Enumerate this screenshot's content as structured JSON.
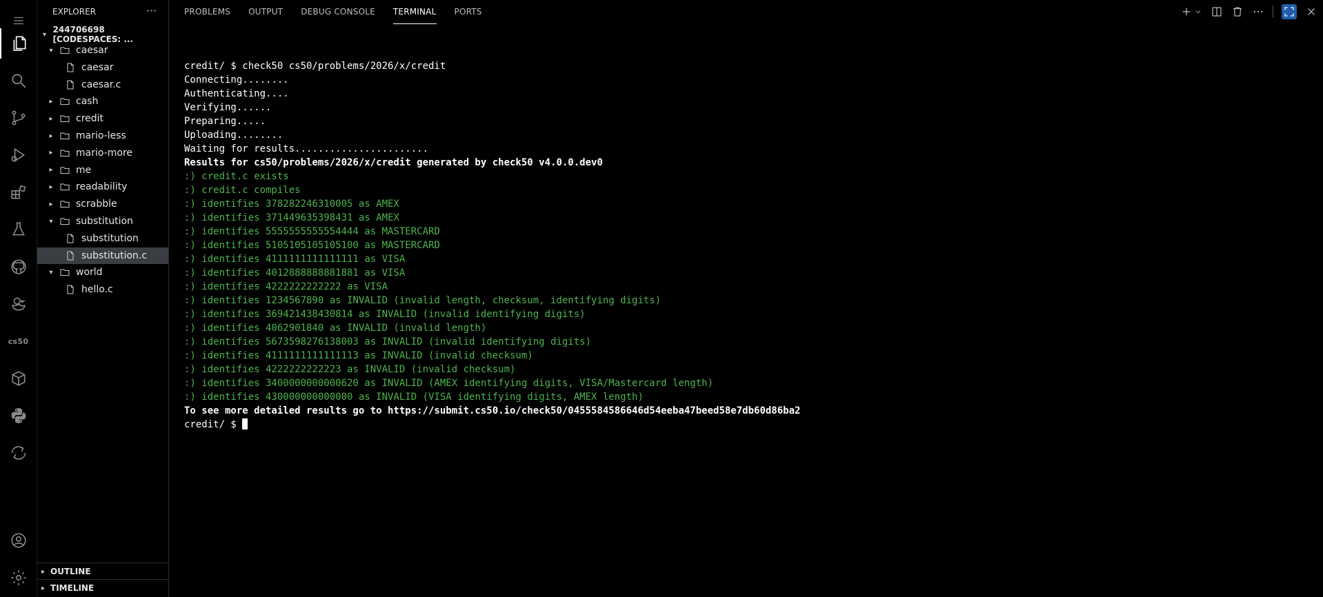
{
  "sidebar": {
    "title": "EXPLORER",
    "more": "···",
    "root": "244706698 [CODESPACES: ...",
    "tree": [
      {
        "label": "caesar",
        "type": "folder",
        "expanded": true,
        "depth": 0
      },
      {
        "label": "caesar",
        "type": "file",
        "depth": 1
      },
      {
        "label": "caesar.c",
        "type": "file",
        "depth": 1
      },
      {
        "label": "cash",
        "type": "folder",
        "expanded": false,
        "depth": 0
      },
      {
        "label": "credit",
        "type": "folder",
        "expanded": false,
        "depth": 0
      },
      {
        "label": "mario-less",
        "type": "folder",
        "expanded": false,
        "depth": 0
      },
      {
        "label": "mario-more",
        "type": "folder",
        "expanded": false,
        "depth": 0
      },
      {
        "label": "me",
        "type": "folder",
        "expanded": false,
        "depth": 0
      },
      {
        "label": "readability",
        "type": "folder",
        "expanded": false,
        "depth": 0
      },
      {
        "label": "scrabble",
        "type": "folder",
        "expanded": false,
        "depth": 0
      },
      {
        "label": "substitution",
        "type": "folder",
        "expanded": true,
        "depth": 0
      },
      {
        "label": "substitution",
        "type": "file",
        "depth": 1
      },
      {
        "label": "substitution.c",
        "type": "file",
        "depth": 1,
        "selected": true
      },
      {
        "label": "world",
        "type": "folder",
        "expanded": true,
        "depth": 0
      },
      {
        "label": "hello.c",
        "type": "file",
        "depth": 1
      }
    ],
    "outline": "OUTLINE",
    "timeline": "TIMELINE"
  },
  "activitybar": {
    "cs50_label": "cs50"
  },
  "panel": {
    "tabs": [
      "PROBLEMS",
      "OUTPUT",
      "DEBUG CONSOLE",
      "TERMINAL",
      "PORTS"
    ],
    "active_tab": "TERMINAL"
  },
  "terminal": {
    "lines": [
      {
        "text": "credit/ $ check50 cs50/problems/2026/x/credit",
        "style": "norm"
      },
      {
        "text": "Connecting........",
        "style": "norm"
      },
      {
        "text": "Authenticating....",
        "style": "norm"
      },
      {
        "text": "Verifying......",
        "style": "norm"
      },
      {
        "text": "Preparing.....",
        "style": "norm"
      },
      {
        "text": "Uploading........",
        "style": "norm"
      },
      {
        "text": "Waiting for results.......................",
        "style": "norm"
      },
      {
        "text": "Results for cs50/problems/2026/x/credit generated by check50 v4.0.0.dev0",
        "style": "bold"
      },
      {
        "text": ":) credit.c exists",
        "style": "green"
      },
      {
        "text": ":) credit.c compiles",
        "style": "green"
      },
      {
        "text": ":) identifies 378282246310005 as AMEX",
        "style": "green"
      },
      {
        "text": ":) identifies 371449635398431 as AMEX",
        "style": "green"
      },
      {
        "text": ":) identifies 5555555555554444 as MASTERCARD",
        "style": "green"
      },
      {
        "text": ":) identifies 5105105105105100 as MASTERCARD",
        "style": "green"
      },
      {
        "text": ":) identifies 4111111111111111 as VISA",
        "style": "green"
      },
      {
        "text": ":) identifies 4012888888881881 as VISA",
        "style": "green"
      },
      {
        "text": ":) identifies 4222222222222 as VISA",
        "style": "green"
      },
      {
        "text": ":) identifies 1234567890 as INVALID (invalid length, checksum, identifying digits)",
        "style": "green"
      },
      {
        "text": ":) identifies 369421438430814 as INVALID (invalid identifying digits)",
        "style": "green"
      },
      {
        "text": ":) identifies 4062901840 as INVALID (invalid length)",
        "style": "green"
      },
      {
        "text": ":) identifies 5673598276138003 as INVALID (invalid identifying digits)",
        "style": "green"
      },
      {
        "text": ":) identifies 4111111111111113 as INVALID (invalid checksum)",
        "style": "green"
      },
      {
        "text": ":) identifies 4222222222223 as INVALID (invalid checksum)",
        "style": "green"
      },
      {
        "text": ":) identifies 3400000000000620 as INVALID (AMEX identifying digits, VISA/Mastercard length)",
        "style": "green"
      },
      {
        "text": ":) identifies 430000000000000 as INVALID (VISA identifying digits, AMEX length)",
        "style": "green"
      },
      {
        "text": "To see more detailed results go to https://submit.cs50.io/check50/0455584586646d54eeba47beed58e7db60d86ba2",
        "style": "bold"
      }
    ],
    "prompt": "credit/ $ "
  },
  "colors": {
    "background": "#000000",
    "pass_green": "#4fb34f",
    "selected_row": "#3a3d41",
    "accent_blue": "#1f5eaa"
  }
}
